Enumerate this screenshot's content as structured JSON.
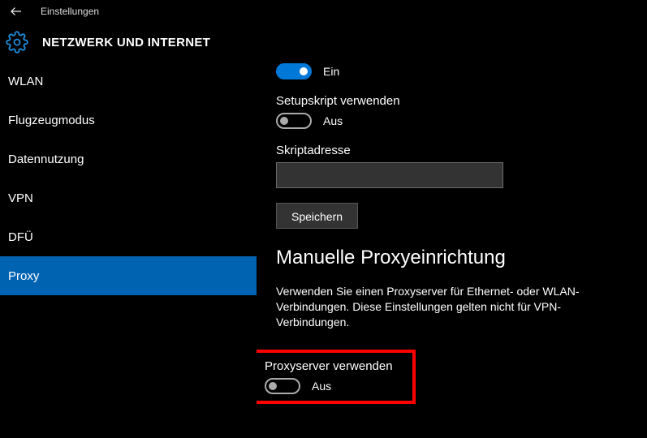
{
  "titlebar": {
    "title": "Einstellungen"
  },
  "header": {
    "title": "NETZWERK UND INTERNET"
  },
  "sidebar": {
    "items": [
      {
        "label": "WLAN"
      },
      {
        "label": "Flugzeugmodus"
      },
      {
        "label": "Datennutzung"
      },
      {
        "label": "VPN"
      },
      {
        "label": "DFÜ"
      },
      {
        "label": "Proxy"
      }
    ],
    "active_index": 5
  },
  "content": {
    "auto_detect": {
      "state": "on",
      "state_label": "Ein"
    },
    "setup_script_label": "Setupskript verwenden",
    "setup_script_toggle": {
      "state": "off",
      "state_label": "Aus"
    },
    "script_address_label": "Skriptadresse",
    "script_address_value": "",
    "save_button": "Speichern",
    "manual_section_title": "Manuelle Proxyeinrichtung",
    "manual_desc": "Verwenden Sie einen Proxyserver für Ethernet- oder WLAN-Verbindungen. Diese Einstellungen gelten nicht für VPN-Verbindungen.",
    "use_proxy_label": "Proxyserver verwenden",
    "use_proxy_toggle": {
      "state": "off",
      "state_label": "Aus"
    }
  }
}
